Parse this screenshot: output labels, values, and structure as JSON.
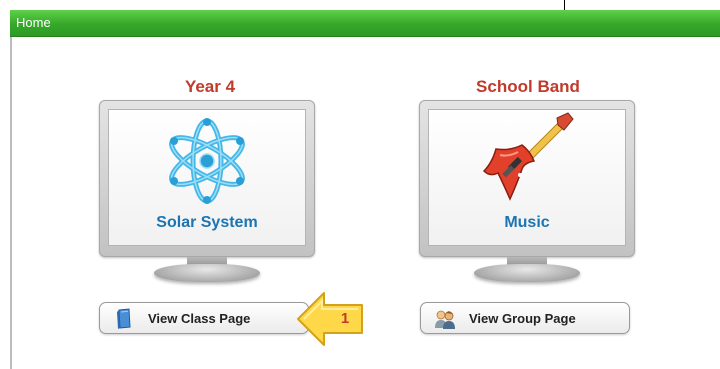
{
  "header": {
    "title": "Home"
  },
  "cards": [
    {
      "group_title": "Year 4",
      "screen_label": "Solar System",
      "icon": "atom-icon",
      "button_label": "View Class Page",
      "button_icon": "book-icon"
    },
    {
      "group_title": "School Band",
      "screen_label": "Music",
      "icon": "guitar-icon",
      "button_label": "View Group Page",
      "button_icon": "people-icon"
    }
  ],
  "callout": {
    "number": "1",
    "icon": "arrow-left-icon"
  },
  "colors": {
    "header_green": "#35a82a",
    "title_red": "#c23a2b",
    "label_blue": "#1c74b2",
    "callout_yellow": "#ffd84a"
  }
}
